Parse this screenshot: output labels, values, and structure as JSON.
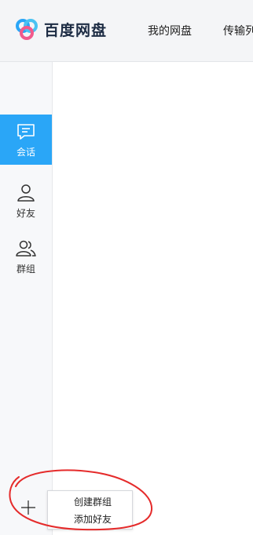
{
  "header": {
    "brand": "百度网盘",
    "nav": [
      "我的网盘",
      "传输列"
    ]
  },
  "sidebar": {
    "items": [
      {
        "label": "会话",
        "icon": "chat-bubble-icon",
        "active": true
      },
      {
        "label": "好友",
        "icon": "person-icon",
        "active": false
      },
      {
        "label": "群组",
        "icon": "people-icon",
        "active": false
      }
    ]
  },
  "add_menu": {
    "button_icon": "plus-icon",
    "items": [
      "创建群组",
      "添加好友"
    ]
  },
  "colors": {
    "accent": "#2aa6f7",
    "annotation": "#e52b2b"
  }
}
